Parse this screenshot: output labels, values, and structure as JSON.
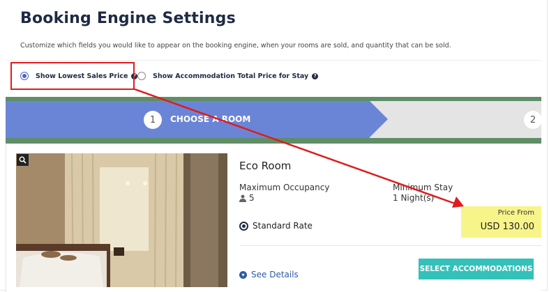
{
  "page": {
    "title": "Booking Engine Settings",
    "description": "Customize which fields you would like to appear on the booking engine, when your rooms are sold, and quantity that can be sold."
  },
  "options": [
    {
      "label": "Show Lowest Sales Price",
      "selected": true,
      "help_icon": "question-circle-icon"
    },
    {
      "label": "Show Accommodation Total Price for Stay",
      "selected": false,
      "help_icon": "question-circle-icon"
    }
  ],
  "preview": {
    "steps": [
      {
        "number": "1",
        "label": "CHOOSE A ROOM",
        "active": true
      },
      {
        "number": "2",
        "active": false
      }
    ],
    "room": {
      "name": "Eco Room",
      "occupancy_label": "Maximum Occupancy",
      "occupancy_value": "5",
      "occupancy_icon": "person-icon",
      "min_stay_label": "Minimum Stay",
      "min_stay_value": "1 Night(s)",
      "rate_label": "Standard Rate",
      "price_from_label": "Price From",
      "price_value": "USD 130.00",
      "see_details": "See Details",
      "select_button": "SELECT ACCOMMODATIONS",
      "zoom_icon": "magnifier-icon"
    }
  },
  "colors": {
    "title": "#1f2a44",
    "step_active": "#6b85d6",
    "step_inactive": "#e4e4e4",
    "green_border": "#5f8e67",
    "price_highlight": "#f7f48a",
    "select_button": "#34c1b9",
    "annotation_red": "#e01b1b"
  }
}
